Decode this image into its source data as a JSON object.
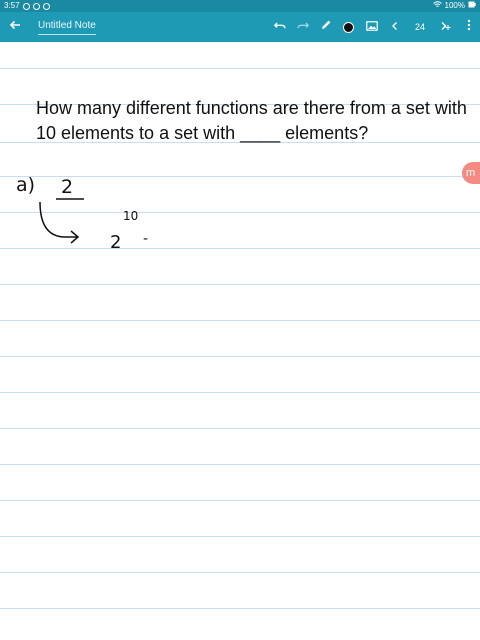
{
  "status": {
    "time": "3:57",
    "battery": "100%"
  },
  "header": {
    "title": "Untitled Note",
    "page_number": "24"
  },
  "icons": {
    "back": "arrow-left-icon",
    "undo": "undo-icon",
    "redo": "redo-icon",
    "pen": "pen-icon",
    "color": "color-dot-icon",
    "image": "image-icon",
    "prev": "chevron-left-icon",
    "next": "next-page-icon",
    "more": "more-vert-icon"
  },
  "note": {
    "question": "How many different functions are there from a set with 10 elements to a set with ____ elements?",
    "handwriting": {
      "label": "a)",
      "base": "2",
      "result_base": "2",
      "exponent": "10",
      "dash": "-"
    }
  },
  "side_tab": {
    "label": "m"
  },
  "colors": {
    "statusbar": "#1a8aa3",
    "appbar": "#1f9ab5",
    "rule_line": "#c8ddee",
    "side_tab": "#f28b82",
    "ink": "#111111"
  }
}
